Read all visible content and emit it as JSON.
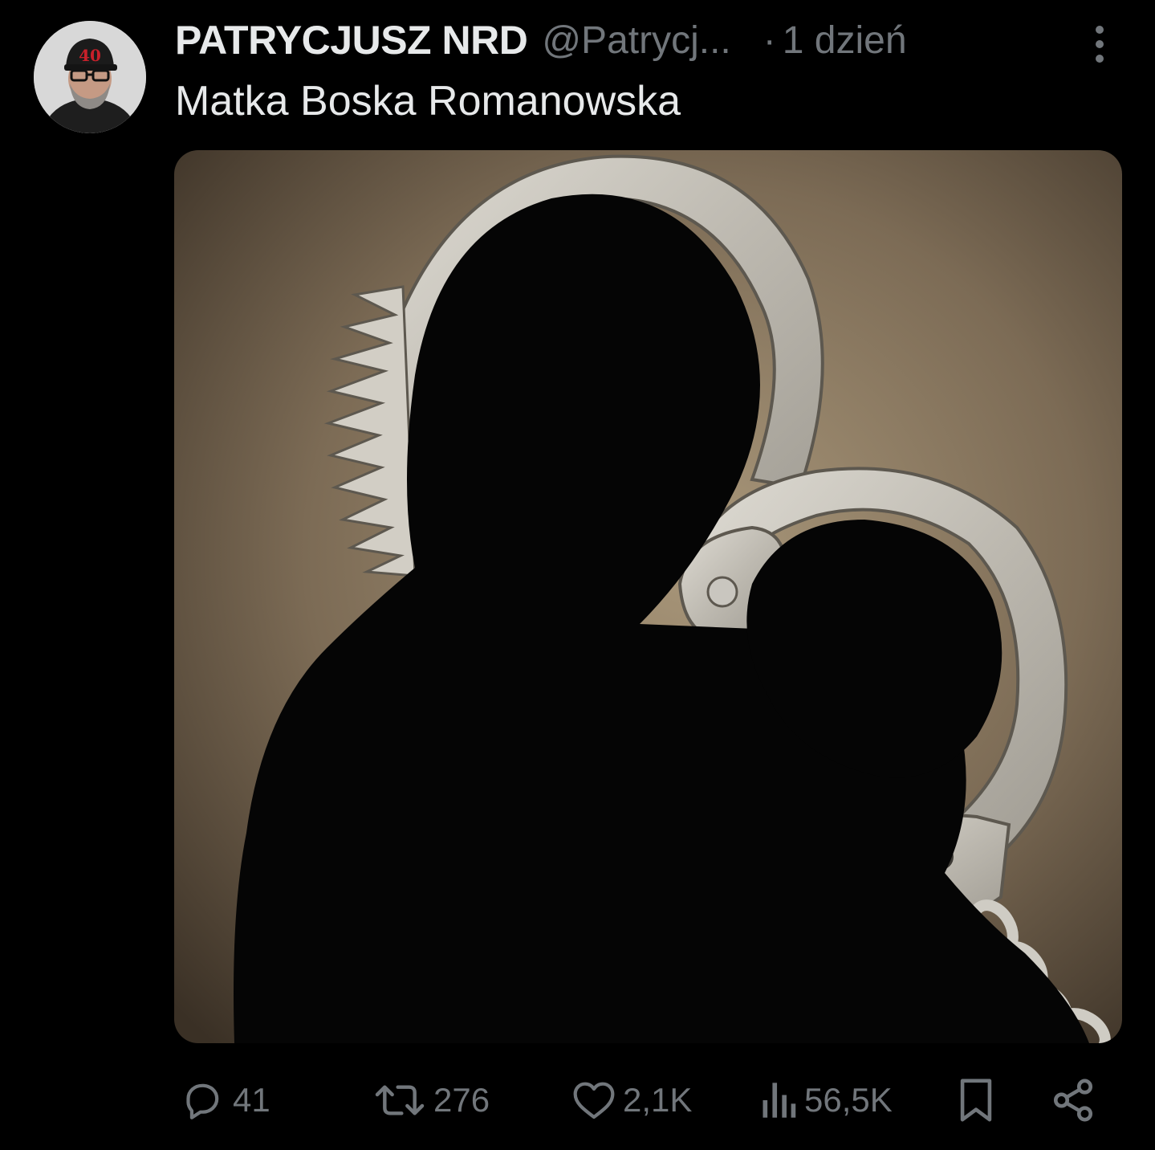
{
  "tweet": {
    "display_name": "PATRYCJUSZ NRD",
    "handle": "@Patrycj...",
    "separator": "·",
    "timestamp": "1 dzień",
    "text": "Matka Boska Romanowska",
    "avatar_icon": "profile-avatar",
    "more_icon": "more-vertical-icon",
    "media_icon": "image-handcuffs-silhouette"
  },
  "actions": {
    "replies": {
      "icon": "reply-icon",
      "count": "41"
    },
    "reposts": {
      "icon": "repost-icon",
      "count": "276"
    },
    "likes": {
      "icon": "heart-icon",
      "count": "2,1K"
    },
    "views": {
      "icon": "views-icon",
      "count": "56,5K"
    },
    "bookmark": {
      "icon": "bookmark-icon"
    },
    "share": {
      "icon": "share-icon"
    }
  },
  "colors": {
    "background": "#000000",
    "primary_text": "#e7e9ea",
    "secondary_text": "#71767b"
  }
}
